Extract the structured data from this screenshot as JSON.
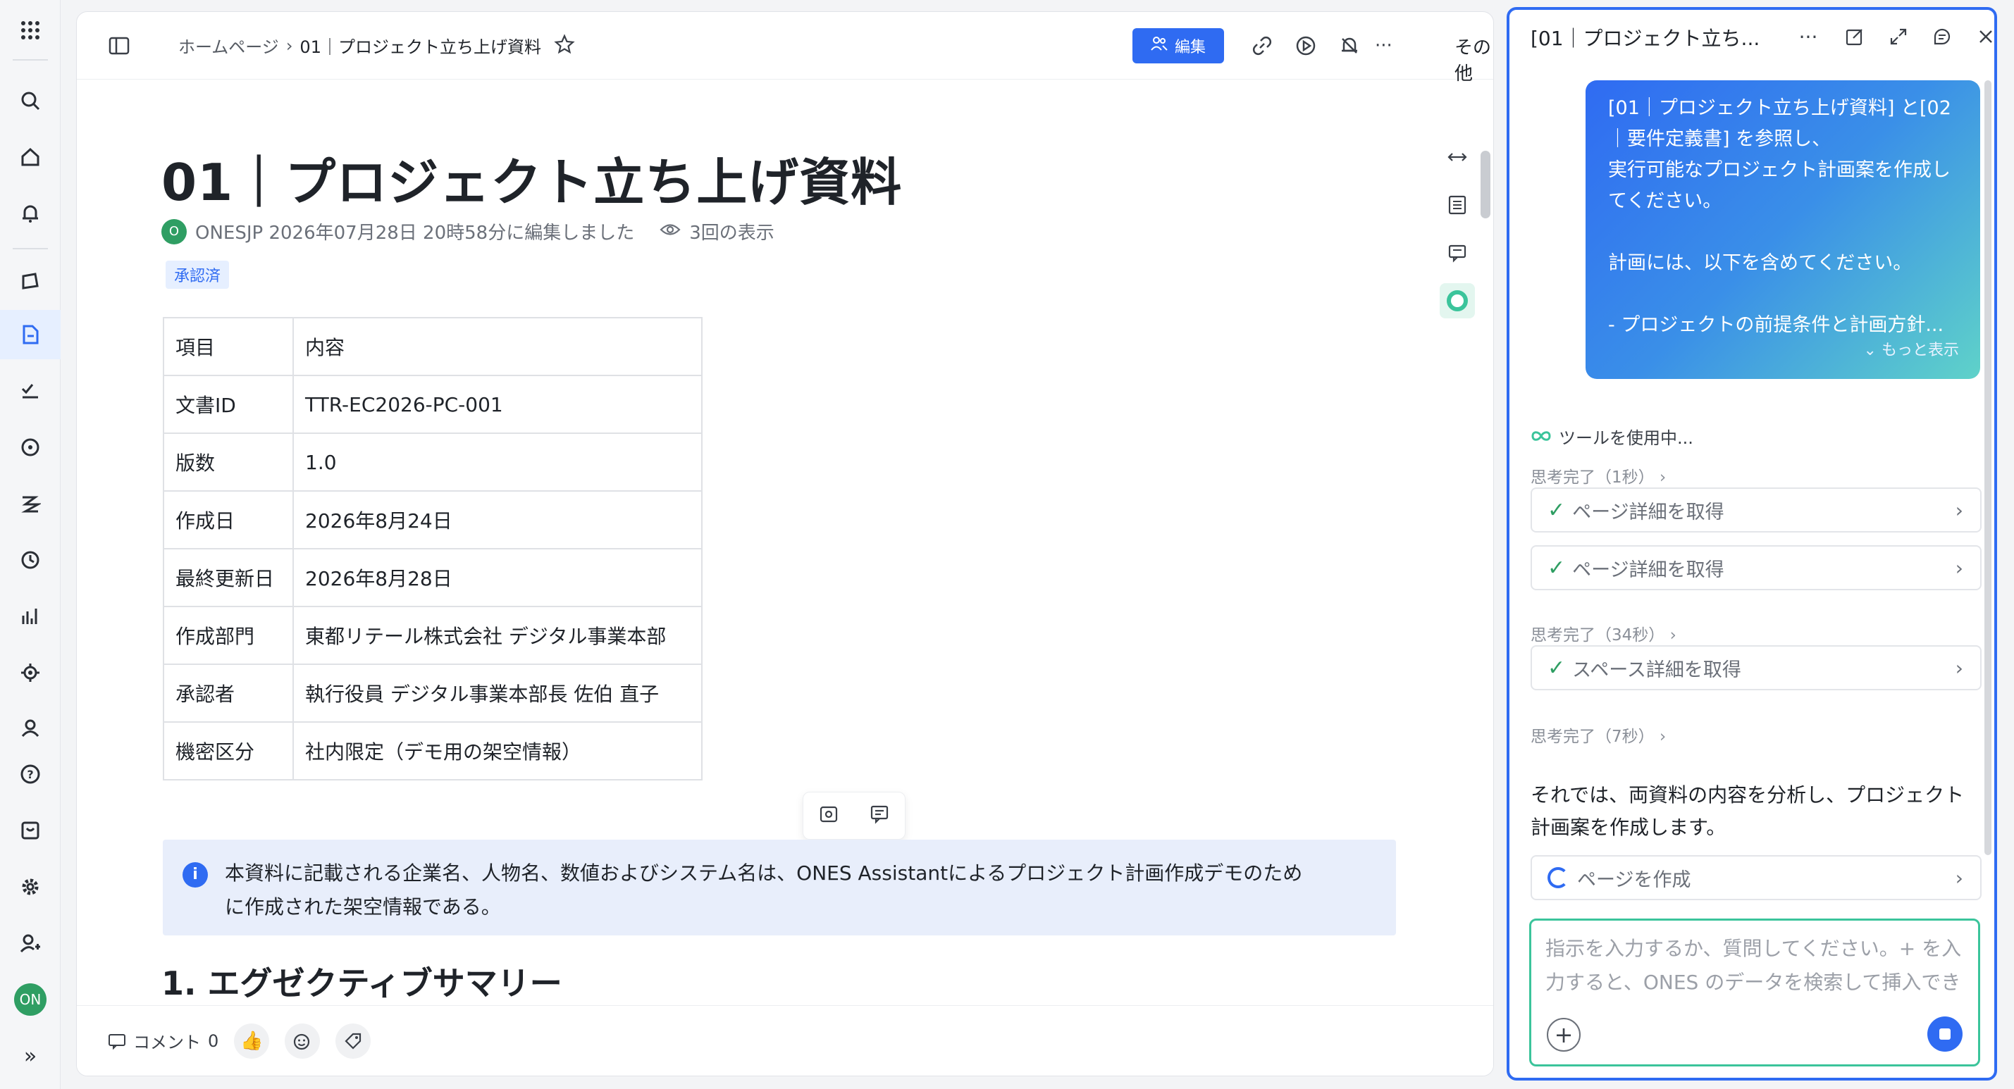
{
  "rail": {
    "avatar": "ON",
    "active_index": 5,
    "items": [
      "apps-grid-icon",
      "search-icon",
      "home-icon",
      "bell-icon",
      "project-icon",
      "document-icon",
      "task-icon",
      "gauge-icon",
      "workflow-icon",
      "clock-icon",
      "analytics-icon",
      "plugin-icon",
      "team-icon",
      "help-icon",
      "inbox-icon",
      "settings-icon",
      "add-user-icon"
    ]
  },
  "header": {
    "breadcrumb_home": "ホームページ",
    "breadcrumb_sep": "›",
    "breadcrumb_current": "01｜プロジェクト立ち上げ資料",
    "edit_label": "編集",
    "more_label": "その他"
  },
  "doc": {
    "title": "01｜プロジェクト立ち上げ資料",
    "meta_avatar": "O",
    "meta_text": "ONESJP 2026年07月28日 20時58分に編集しました",
    "views": "3回の表示",
    "tag": "承認済",
    "table": [
      {
        "k": "項目",
        "v": "内容"
      },
      {
        "k": "文書ID",
        "v": "TTR-EC2026-PC-001"
      },
      {
        "k": "版数",
        "v": "1.0"
      },
      {
        "k": "作成日",
        "v": "2026年8月24日"
      },
      {
        "k": "最終更新日",
        "v": "2026年8月28日"
      },
      {
        "k": "作成部門",
        "v": "東都リテール株式会社 デジタル事業本部"
      },
      {
        "k": "承認者",
        "v": "執行役員 デジタル事業本部長 佐伯 直子"
      },
      {
        "k": "機密区分",
        "v": "社内限定（デモ用の架空情報）"
      }
    ],
    "callout_line1": "本資料に記載される企業名、人物名、数値およびシステム名は、ONES Assistantによるプロジェクト計画作成デモのため",
    "callout_line2": "に作成された架空情報である。",
    "section_heading": "1. エグゼクティブサマリー"
  },
  "footer": {
    "comment_label": "コメント",
    "comment_count": "0"
  },
  "panel": {
    "title": "[01｜プロジェクト立ち...",
    "user_msg_lines": [
      "[01｜プロジェクト立ち上げ資料] と[02",
      "｜要件定義書] を参照し、",
      "実行可能なプロジェクト計画案を作成し",
      "てください。",
      "",
      "計画には、以下を含めてください。",
      "",
      "- プロジェクトの前提条件と計画方針..."
    ],
    "show_more": "もっと表示",
    "tool_using": "ツールを使用中...",
    "think1": "思考完了（1秒）",
    "step1": "ページ詳細を取得",
    "step2": "ページ詳細を取得",
    "think2": "思考完了（34秒）",
    "step3": "スペース詳細を取得",
    "think3": "思考完了（7秒）",
    "reply": "それでは、両資料の内容を分析し、プロジェクト計画案を作成します。",
    "step4": "ページを作成",
    "input_placeholder": "指示を入力するか、質問してください。+ を入力すると、ONES のデータを検索して挿入できます"
  }
}
